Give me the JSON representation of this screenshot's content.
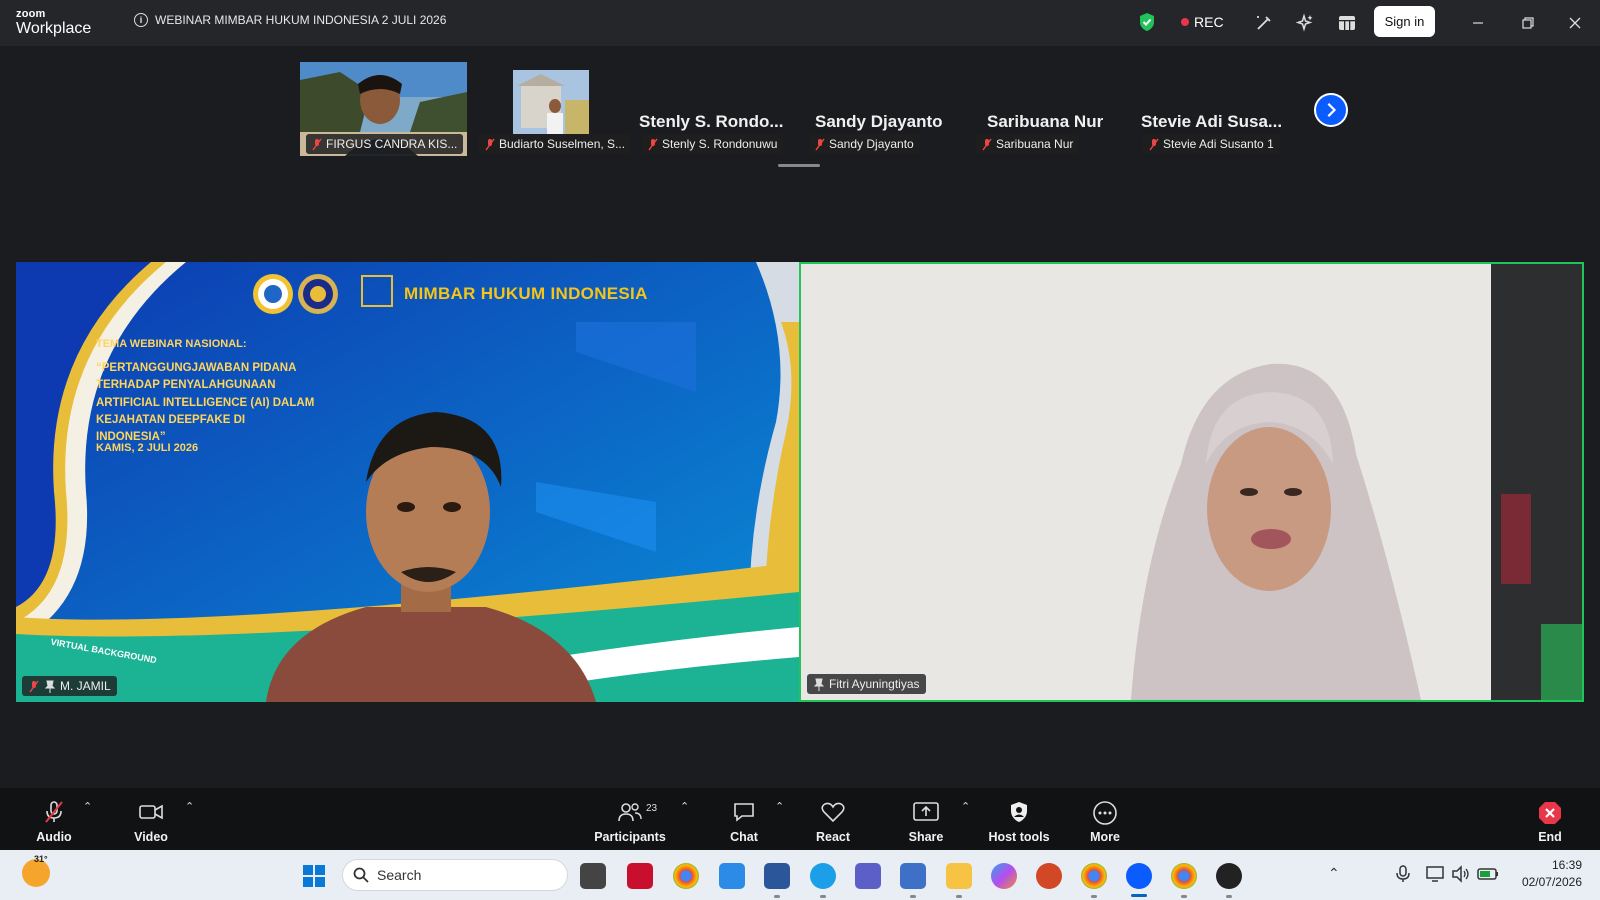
{
  "titlebar": {
    "brand_top": "zoom",
    "brand_bottom": "Workplace",
    "meeting_title": "WEBINAR MIMBAR HUKUM INDONESIA 2 JULI 2026",
    "rec_label": "REC",
    "sign_in": "Sign in"
  },
  "filmstrip": {
    "thumbs": [
      {
        "name": "FIRGUS CANDRA KIS..."
      },
      {
        "name": "Budiarto Suselmen, S..."
      },
      {
        "name": "Stenly S. Rondonuwu",
        "big": "Stenly S. Rondo..."
      },
      {
        "name": "Sandy Djayanto",
        "big": "Sandy Djayanto"
      },
      {
        "name": "Saribuana Nur",
        "big": "Saribuana Nur"
      },
      {
        "name": "Stevie Adi Susanto 1",
        "big": "Stevie Adi Susa..."
      }
    ]
  },
  "main": {
    "left": {
      "name": "M. JAMIL",
      "org": "MIMBAR HUKUM INDONESIA",
      "theme_label": "TEMA WEBINAR NASIONAL:",
      "theme_text": "“PERTANGGUNGJAWABAN PIDANA TERHADAP PENYALAHGUNAAN ARTIFICIAL INTELLIGENCE (AI) DALAM KEJAHATAN DEEPFAKE DI INDONESIA”",
      "date": "KAMIS, 2 JULI 2026",
      "vbg": "VIRTUAL BACKGROUND"
    },
    "right": {
      "name": "Fitri Ayuningtiyas"
    }
  },
  "controls": {
    "audio": "Audio",
    "video": "Video",
    "participants": "Participants",
    "participants_count": "23",
    "chat": "Chat",
    "react": "React",
    "share": "Share",
    "host_tools": "Host tools",
    "more": "More",
    "end": "End"
  },
  "taskbar": {
    "temp": "31°",
    "search": "Search",
    "time": "16:39",
    "date": "02/07/2026"
  }
}
